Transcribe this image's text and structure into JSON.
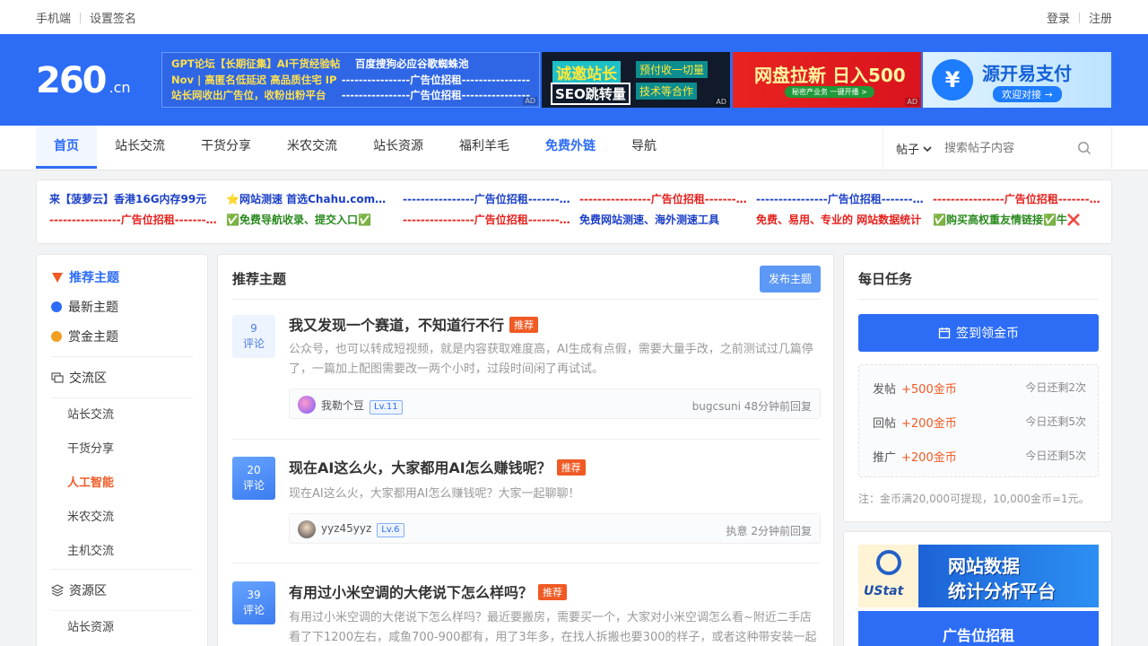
{
  "topbar": {
    "mobile": "手机端",
    "signature": "设置签名",
    "login": "登录",
    "register": "注册"
  },
  "header": {
    "logo_main": "260",
    "logo_suffix": ".cn",
    "text_ads": [
      [
        "GPT论坛【长期征集】AI干货经验帖",
        "百度搜狗必应谷歌蜘蛛池"
      ],
      [
        "Nov | 高匿名低延迟 高品质住宅 IP",
        "----------------广告位招租----------------"
      ],
      [
        "站长网收出广告位，收粉出粉平台",
        "----------------广告位招租----------------"
      ]
    ],
    "ad_label": "AD",
    "banner1": {
      "a": "诚邀站长",
      "b": "SEO跳转量",
      "c": "预付收一切量",
      "d": "技术等合作"
    },
    "banner2": {
      "a": "网盘拉新 日入500",
      "b": "秘密产业务 一键开播 >"
    },
    "banner3": {
      "coin": "¥",
      "a": "源开易支付",
      "b": "欢迎对接 →"
    }
  },
  "nav": {
    "items": [
      "首页",
      "站长交流",
      "干货分享",
      "米农交流",
      "站长资源",
      "福利羊毛",
      "免费外链",
      "导航"
    ],
    "search_type": "帖子",
    "search_placeholder": "搜索帖子内容"
  },
  "ad_links": [
    {
      "text": "来【菠萝云】香港16G内存99元",
      "color": "#1b3fc7"
    },
    {
      "text": "⭐网站测速 首选Chahu.com⭐ 🔥",
      "color": "#1b3fc7"
    },
    {
      "text": "----------------广告位招租----------------",
      "color": "#1b3fc7"
    },
    {
      "text": "----------------广告位招租----------------",
      "color": "#e5211d"
    },
    {
      "text": "----------------广告位招租----------------",
      "color": "#1b3fc7"
    },
    {
      "text": "----------------广告位招租----------------",
      "color": "#e5211d"
    },
    {
      "text": "----------------广告位招租----------------",
      "color": "#e5211d"
    },
    {
      "text": "✅免费导航收录、提交入口✅",
      "color": "#2a8a1f"
    },
    {
      "text": "----------------广告位招租----------------",
      "color": "#e5211d"
    },
    {
      "text": "免费网站测速、海外测速工具",
      "color": "#1b3fc7"
    },
    {
      "text": "免费、易用、专业的 网站数据统计",
      "color": "#e5211d"
    },
    {
      "text": "✅购买高权重友情链接✅牛❌",
      "color": "#2a8a1f"
    }
  ],
  "sidebar": {
    "top": [
      {
        "label": "推荐主题",
        "color": "#f05a24"
      },
      {
        "label": "最新主题",
        "color": "#2d6df6"
      },
      {
        "label": "赏金主题",
        "color": "#f0a020"
      }
    ],
    "section1": "交流区",
    "section1_items": [
      "站长交流",
      "干货分享",
      "人工智能",
      "米农交流",
      "主机交流"
    ],
    "section2": "资源区",
    "section2_items": [
      "站长资源"
    ]
  },
  "main": {
    "title": "推荐主题",
    "post_button": "发布主题",
    "posts": [
      {
        "count": "9",
        "count_label": "评论",
        "title": "我又发现一个赛道，不知道行不行",
        "tag": "推荐",
        "excerpt": "公众号，也可以转成短视频，就是内容获取难度高，AI生成有点假，需要大量手改，之前测试过几篇停了，一篇加上配图需要改一两个小时，过段时间闲了再试试。",
        "user": "我勒个豆",
        "level": "Lv.11",
        "reply": "bugcsuni 48分钟前回复"
      },
      {
        "count": "20",
        "count_label": "评论",
        "title": "现在AI这么火，大家都用AI怎么赚钱呢？",
        "tag": "推荐",
        "excerpt": "现在AI这么火，大家都用AI怎么赚钱呢？大家一起聊聊！",
        "user": "yyz45yyz",
        "level": "Lv.6",
        "reply": "执意 2分钟前回复"
      },
      {
        "count": "39",
        "count_label": "评论",
        "title": "有用过小米空调的大佬说下怎么样吗？",
        "tag": "推荐",
        "excerpt": "有用过小米空调的大佬说下怎么样吗？最近要搬房，需要买一个，大家对小米空调怎么看~附近二手店看了下1200左右，咸鱼700-900都有，用了3年多，在找人拆搬也要300的样子，或者这种带安装一起可..."
      }
    ]
  },
  "tasks": {
    "title": "每日任务",
    "sign_button": "签到领金币",
    "items": [
      {
        "action": "发帖",
        "reward": "+500金币",
        "left": "今日还剩2次"
      },
      {
        "action": "回帖",
        "reward": "+200金币",
        "left": "今日还剩5次"
      },
      {
        "action": "推广",
        "reward": "+200金币",
        "left": "今日还剩5次"
      }
    ],
    "note": "注：金币满20,000可提现，10,000金币=1元。"
  },
  "side_ad": {
    "brand": "UStat",
    "line1": "网站数据",
    "line2": "统计分析平台",
    "rent": "广告位招租"
  }
}
